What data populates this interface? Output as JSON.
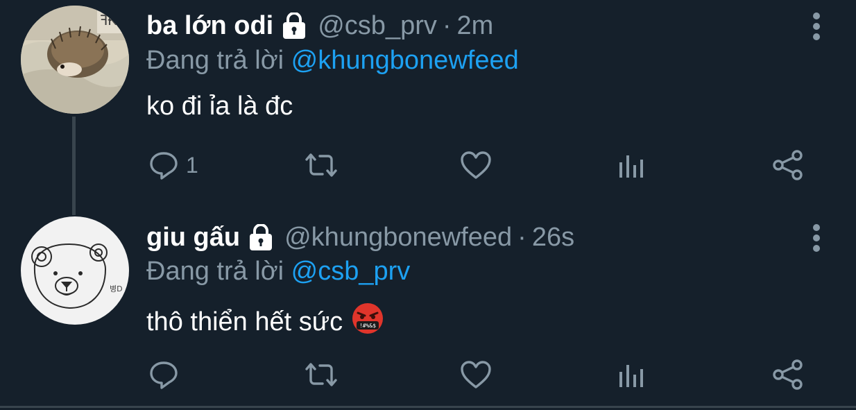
{
  "tweets": [
    {
      "name": "ba lớn odi",
      "handle": "@csb_prv",
      "separator": "·",
      "time": "2m",
      "reply_prefix": "Đang trả lời",
      "reply_to": "@khungbonewfeed",
      "text": "ko đi ỉa là đc",
      "emoji": "",
      "reply_count": "1",
      "avatar_icon": "hedgehog-photo"
    },
    {
      "name": "giu gấu",
      "handle": "@khungbonewfeed",
      "separator": "·",
      "time": "26s",
      "reply_prefix": "Đang trả lời",
      "reply_to": "@csb_prv",
      "text": "thô thiển hết sức",
      "emoji": "🤬",
      "reply_count": "",
      "avatar_icon": "bear-drawing",
      "avatar_text": "병D"
    }
  ],
  "colors": {
    "background": "#15202b",
    "secondary_text": "#8899a6",
    "accent": "#1da1f2",
    "icon": "#8899a6"
  }
}
